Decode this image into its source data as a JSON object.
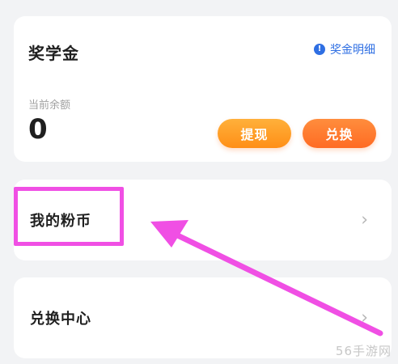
{
  "scholarship": {
    "title": "奖学金",
    "details_link": "奖金明细",
    "info_icon": "!",
    "balance_label": "当前余额",
    "balance_value": "0",
    "withdraw_label": "提现",
    "exchange_label": "兑换"
  },
  "menu": {
    "my_coins": "我的粉币",
    "exchange_center": "兑换中心",
    "chevron": "›"
  },
  "annotation": {
    "highlight_color": "#f04fe4",
    "arrow_color": "#f04fe4"
  },
  "watermark": "56手游网"
}
